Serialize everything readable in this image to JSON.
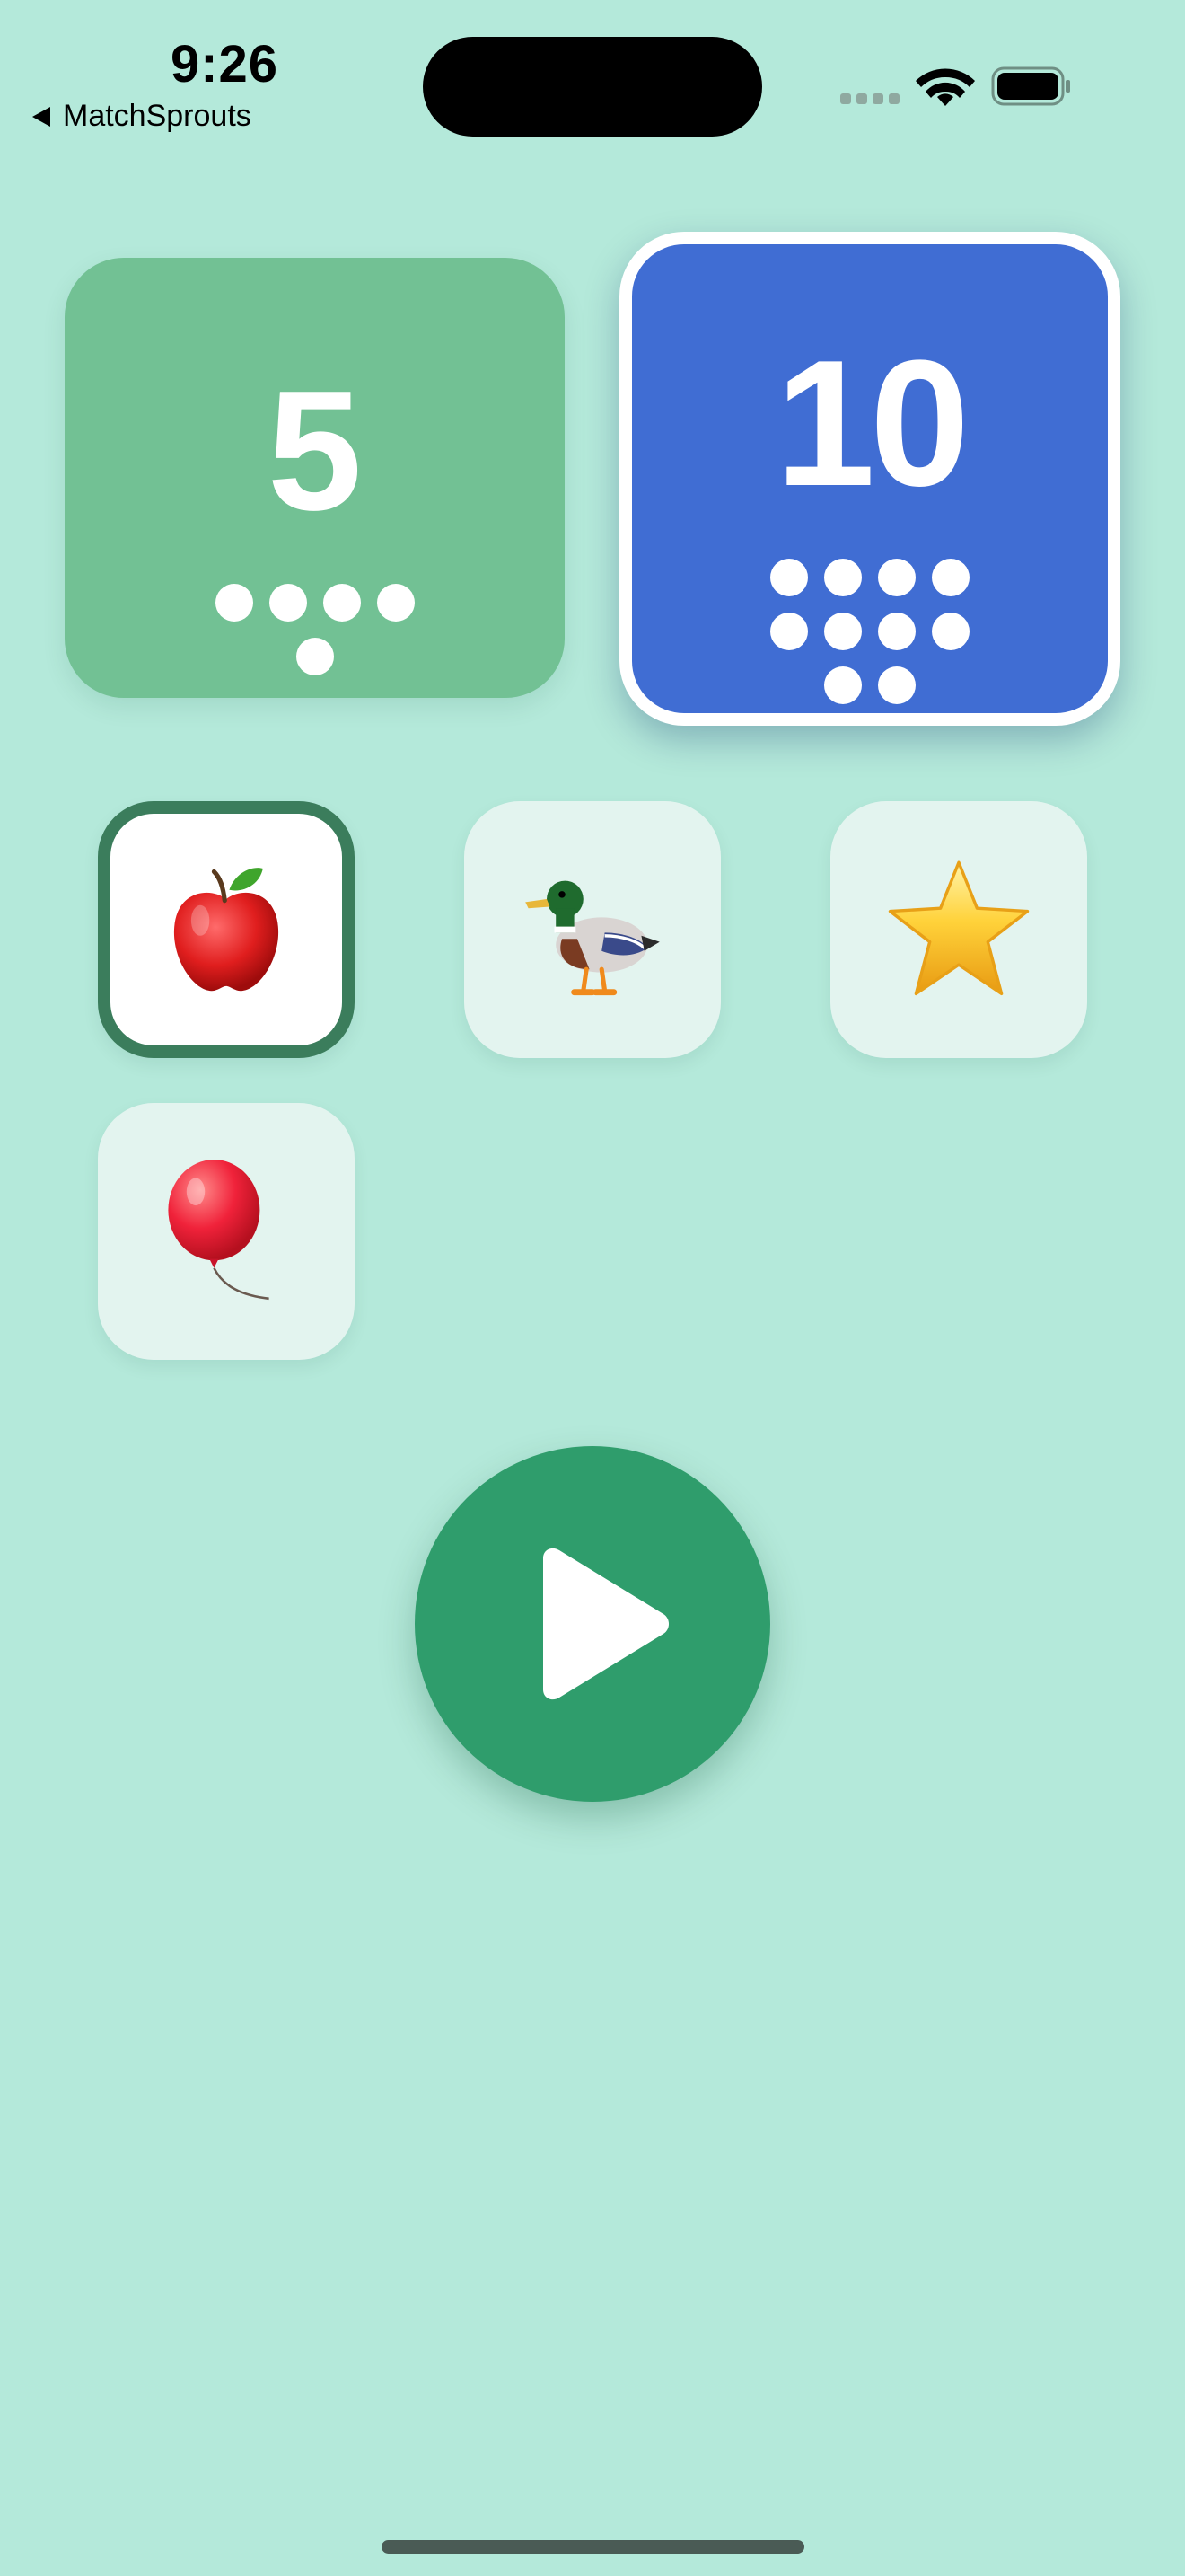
{
  "status_bar": {
    "time": "9:26",
    "back_label": "MatchSprouts",
    "icons": [
      "signal-icon",
      "wifi-icon",
      "battery-icon"
    ]
  },
  "number_choices": [
    {
      "label": "5",
      "dots": 5,
      "color": "#72c194",
      "selected": false
    },
    {
      "label": "10",
      "dots": 10,
      "color": "#406dd3",
      "selected": true
    }
  ],
  "object_tiles": [
    {
      "icon": "apple-icon",
      "selected": true
    },
    {
      "icon": "duck-icon",
      "selected": false
    },
    {
      "icon": "star-icon",
      "selected": false
    },
    {
      "icon": "balloon-icon",
      "selected": false
    }
  ],
  "play_button": {
    "icon": "play-icon",
    "color": "#2f9d6c"
  },
  "colors": {
    "background": "#b4e9da",
    "tile": "#e3f4ef",
    "selected_border": "#3b7d5c"
  }
}
